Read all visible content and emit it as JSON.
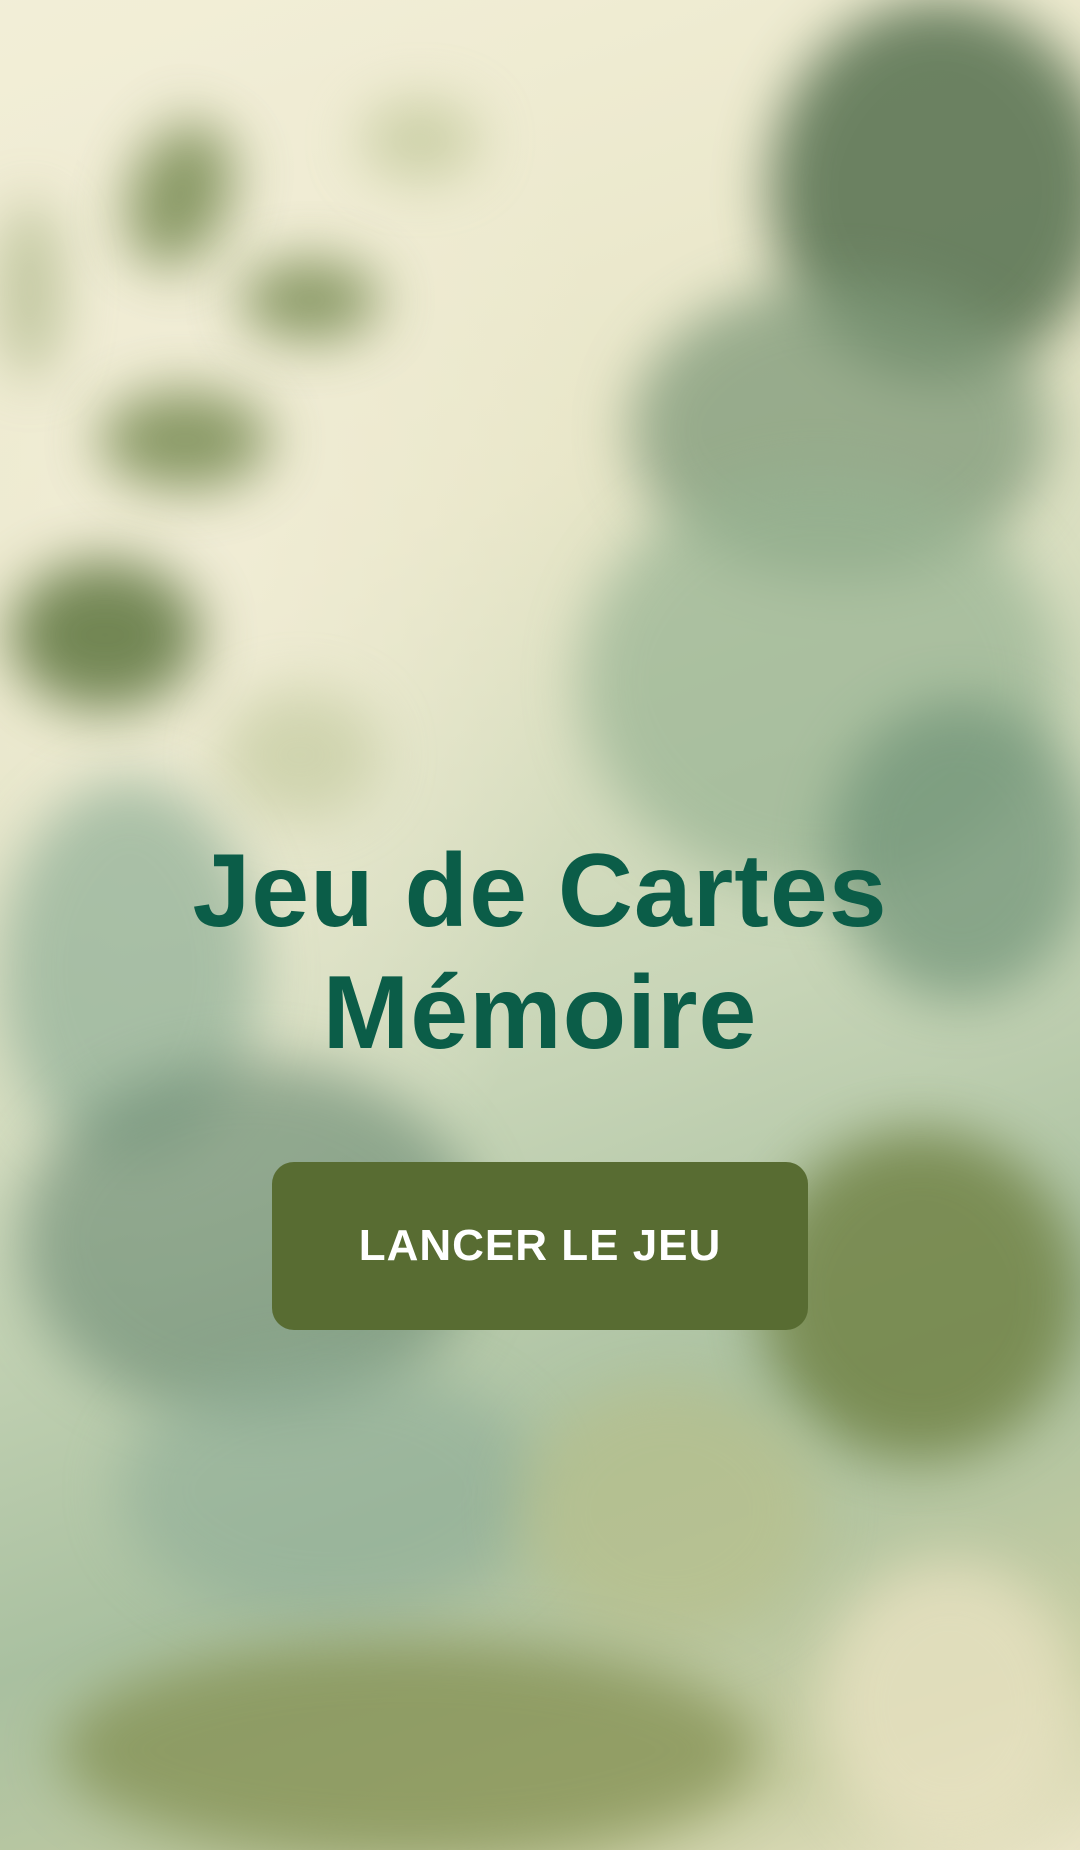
{
  "screen": {
    "title_line1": "Jeu de Cartes",
    "title_line2": "Mémoire",
    "start_button_label": "LANCER LE JEU"
  },
  "colors": {
    "title": "#0b5d48",
    "button_background": "#586c32",
    "button_text": "#ffffff"
  }
}
